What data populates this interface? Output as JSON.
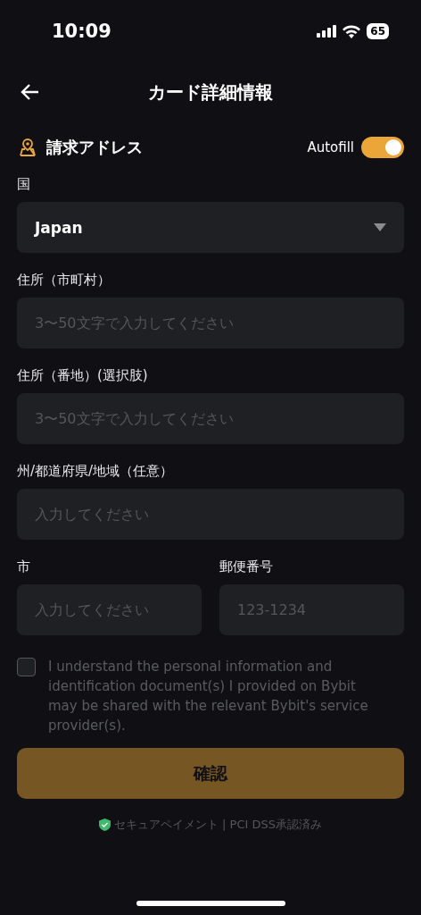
{
  "status_bar": {
    "time": "10:09",
    "battery": "65"
  },
  "header": {
    "title": "カード詳細情報"
  },
  "section": {
    "title": "請求アドレス",
    "autofill_label": "Autofill",
    "autofill_on": true
  },
  "rows": [
    {
      "fields": [
        {
          "label": "国",
          "kind": "select",
          "value": "Japan"
        }
      ]
    },
    {
      "fields": [
        {
          "label": "住所（市町村）",
          "kind": "text",
          "placeholder": "3〜50文字で入力してください"
        }
      ]
    },
    {
      "fields": [
        {
          "label": "住所（番地）(選択肢)",
          "kind": "text",
          "placeholder": "3〜50文字で入力してください"
        }
      ]
    },
    {
      "fields": [
        {
          "label": "州/都道府県/地域（任意）",
          "kind": "text",
          "placeholder": "入力してください"
        }
      ]
    },
    {
      "fields": [
        {
          "label": "市",
          "kind": "text",
          "placeholder": "入力してください"
        },
        {
          "label": "郵便番号",
          "kind": "text",
          "placeholder": "123-1234"
        }
      ]
    }
  ],
  "consent": {
    "checked": false,
    "text": "I understand the personal information and identification document(s) I provided on Bybit may be shared with the relevant Bybit's service provider(s)."
  },
  "confirm_button": {
    "label": "確認",
    "disabled": true
  },
  "footer": "セキュアペイメント | PCI DSS承認済み"
}
